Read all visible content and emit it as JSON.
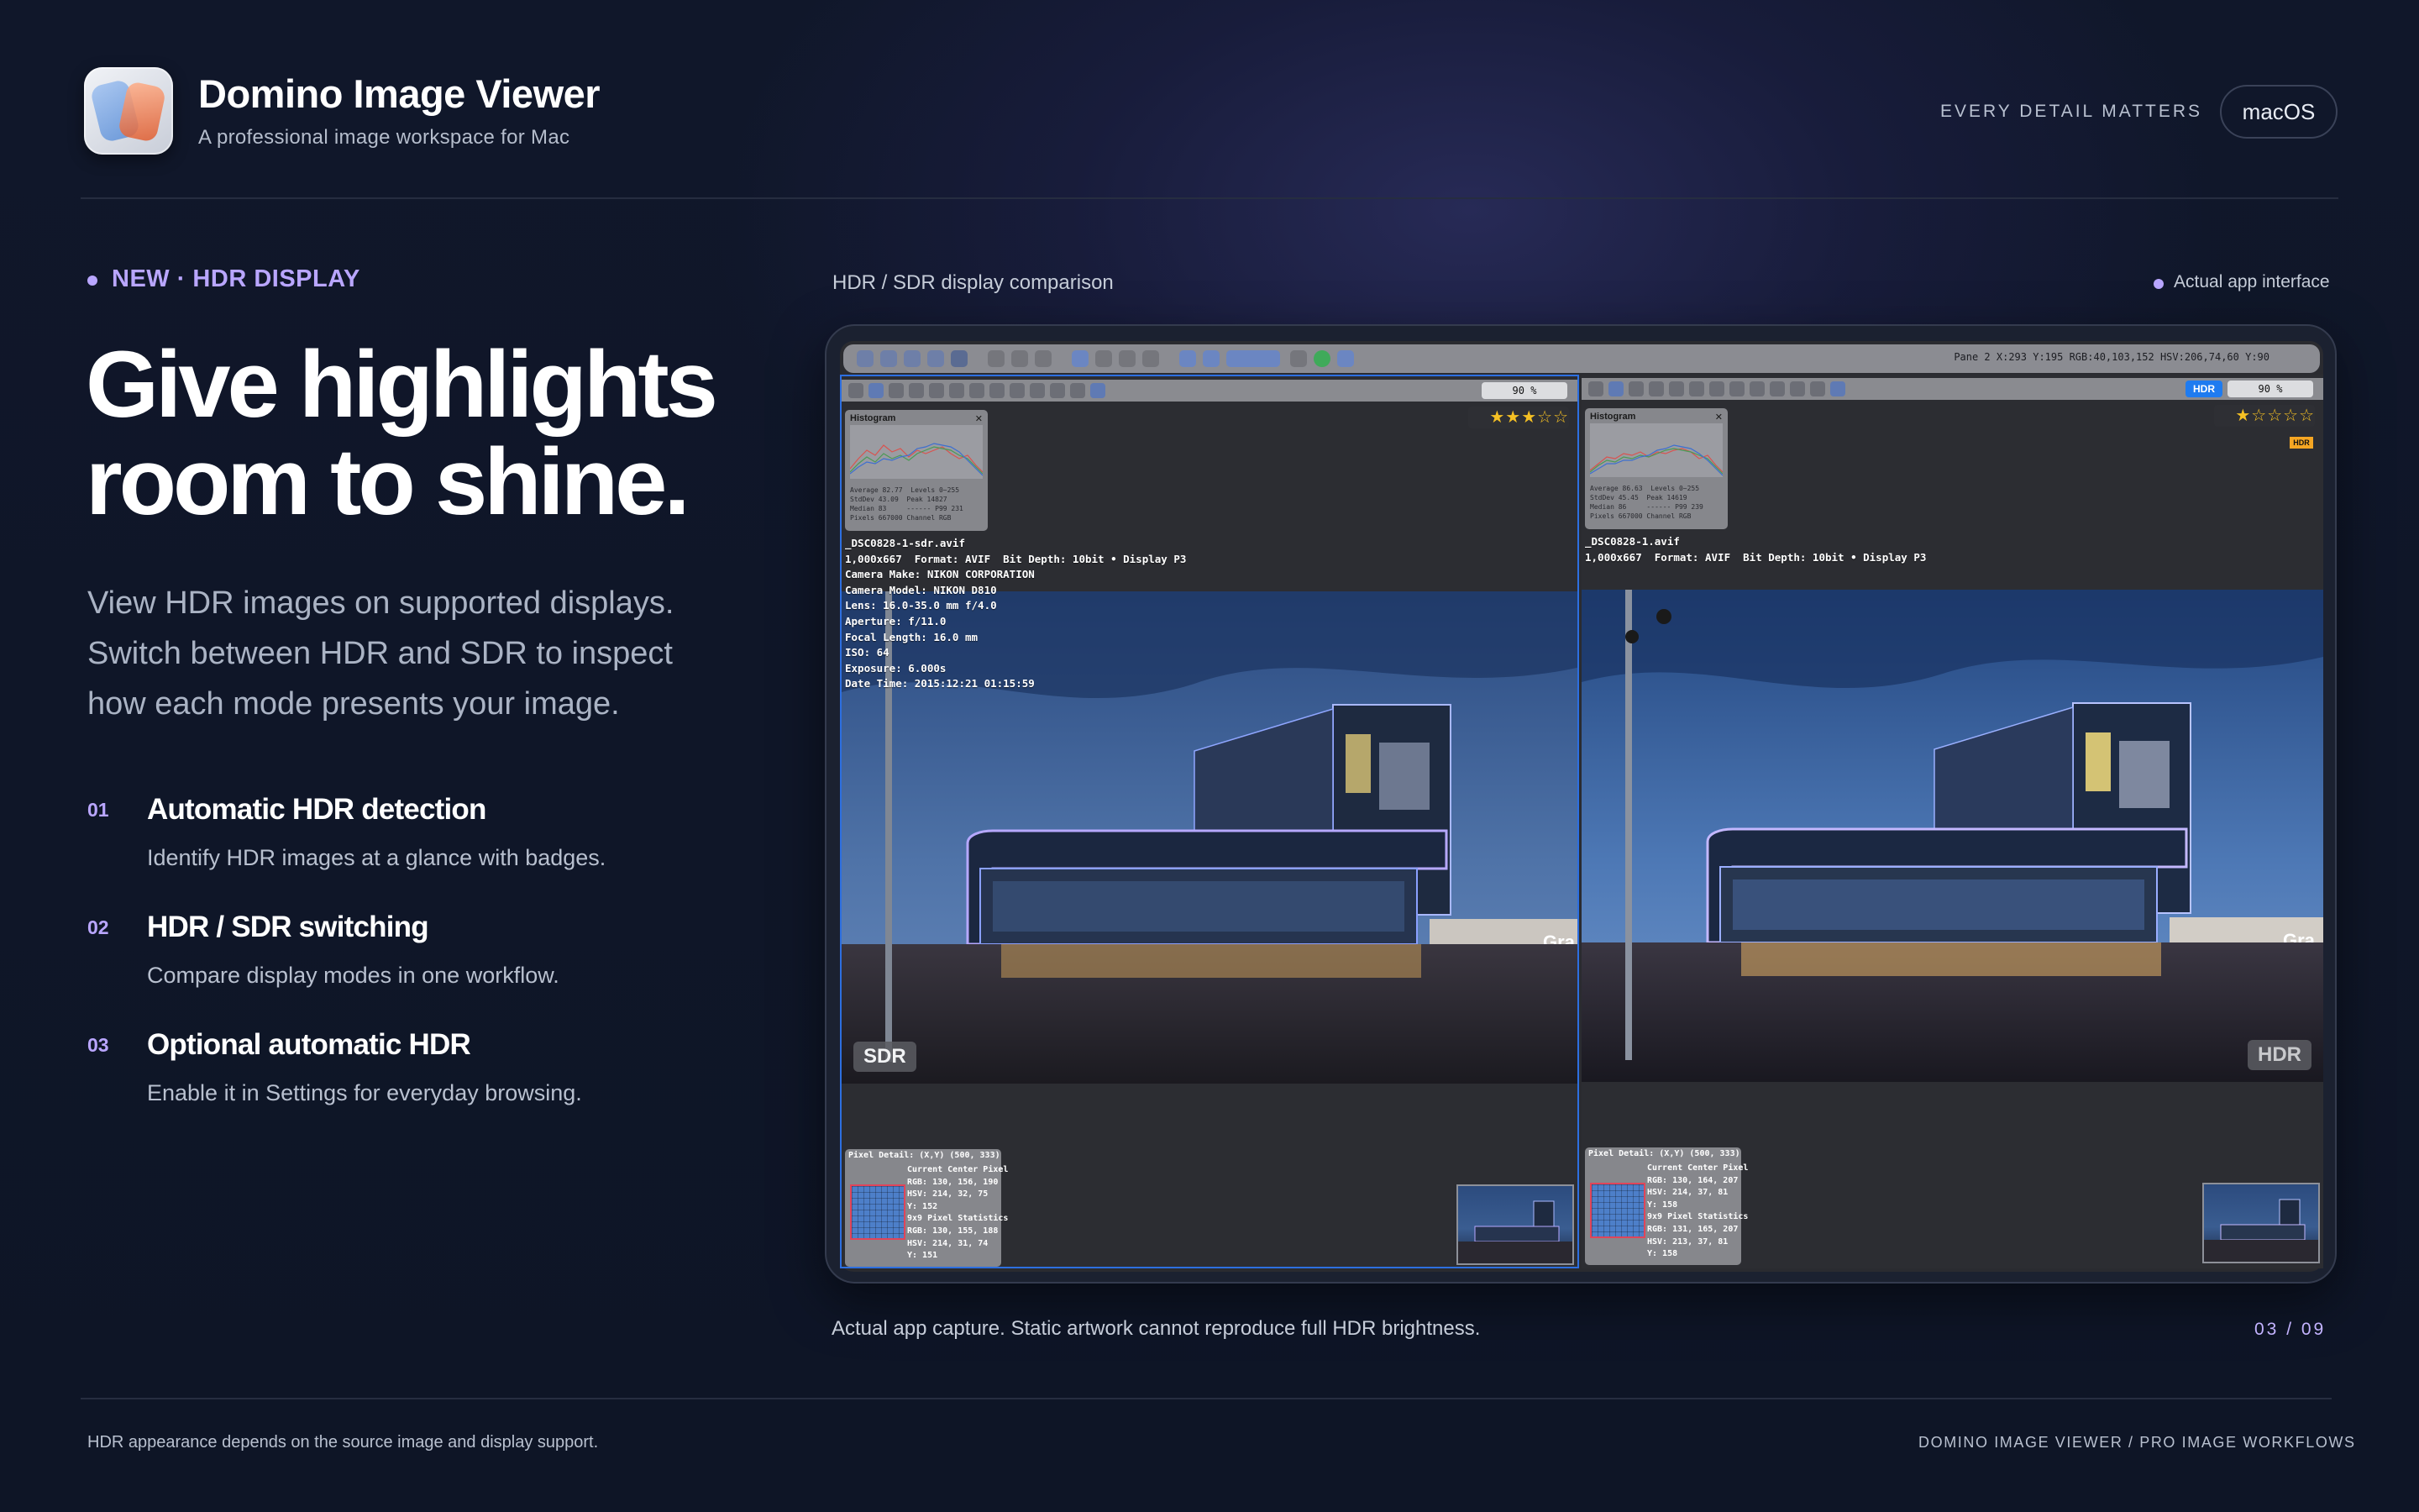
{
  "brand": {
    "title": "Domino Image Viewer",
    "subtitle": "A professional image workspace for Mac"
  },
  "header": {
    "tagline": "EVERY DETAIL MATTERS",
    "platform": "macOS"
  },
  "hero": {
    "badge": "NEW · HDR DISPLAY",
    "headline_line1": "Give highlights",
    "headline_line2": "room to shine.",
    "lede_line1": "View HDR images on supported displays.",
    "lede_line2": "Switch between HDR and SDR to inspect",
    "lede_line3": "how each mode presents your image."
  },
  "features": [
    {
      "number": "01",
      "title": "Automatic HDR detection",
      "description": "Identify HDR images at a glance with badges."
    },
    {
      "number": "02",
      "title": "HDR / SDR switching",
      "description": "Compare display modes in one workflow."
    },
    {
      "number": "03",
      "title": "Optional automatic HDR",
      "description": "Enable it in Settings for everyday browsing."
    }
  ],
  "showcase": {
    "label": "HDR / SDR display comparison",
    "live_label": "Actual app interface",
    "caption": "Actual app capture. Static artwork cannot reproduce full HDR brightness.",
    "pager": "03 / 09"
  },
  "app": {
    "status_bar": "Pane 2   X:293 Y:195   RGB:40,103,152   HSV:206,74,60   Y:90",
    "left_pane": {
      "zoom": "90  %",
      "stars": "★★★☆☆",
      "rating": 3,
      "histogram_title": "Histogram",
      "histogram_stats": "Average 82.77  Levels 0~255\nStdDev 43.09  Peak 14827\nMedian 83     ------ P99 231\nPixels 667000 Channel RGB",
      "meta": "_DSC0828-1-sdr.avif\n1,000x667  Format: AVIF  Bit Depth: 10bit • Display P3\nCamera Make: NIKON CORPORATION\nCamera Model: NIKON D810\nLens: 16.0-35.0 mm f/4.0\nAperture: f/11.0\nFocal Length: 16.0 mm\nISO: 64\nExposure: 6.000s\nDate Time: 2015:12:21 01:15:59",
      "mode": "SDR",
      "pixel_header": "Pixel Detail: (X,Y) (500, 333)",
      "pixel_text": "Current Center Pixel\nRGB: 130, 156, 190\nHSV: 214, 32, 75\nY: 152\n9x9 Pixel Statistics\nRGB: 130, 155, 188\nHSV: 214, 31, 74\nY: 151"
    },
    "right_pane": {
      "zoom": "90  %",
      "hdr_toggle": "HDR",
      "stars": "★☆☆☆☆",
      "rating": 1,
      "hdr_badge": "HDR",
      "histogram_title": "Histogram",
      "histogram_stats": "Average 86.63  Levels 0~255\nStdDev 45.45  Peak 14619\nMedian 86     ------ P99 239\nPixels 667000 Channel RGB",
      "meta": "_DSC0828-1.avif\n1,000x667  Format: AVIF  Bit Depth: 10bit • Display P3",
      "mode": "HDR",
      "pixel_header": "Pixel Detail: (X,Y) (500, 333)",
      "pixel_text": "Current Center Pixel\nRGB: 130, 164, 207\nHSV: 214, 37, 81\nY: 158\n9x9 Pixel Statistics\nRGB: 131, 165, 207\nHSV: 213, 37, 81\nY: 158"
    },
    "building_sign": "Gra"
  },
  "footer": {
    "note": "HDR appearance depends on the source image and display support.",
    "credit": "DOMINO IMAGE VIEWER / PRO IMAGE WORKFLOWS"
  },
  "colors": {
    "accent": "#b9a6ff",
    "background": "#0e1526",
    "selection_blue": "#2d6fe0",
    "star": "#f5c024"
  },
  "icons": [
    "app-logo-icon",
    "hdr-badge-icon"
  ]
}
